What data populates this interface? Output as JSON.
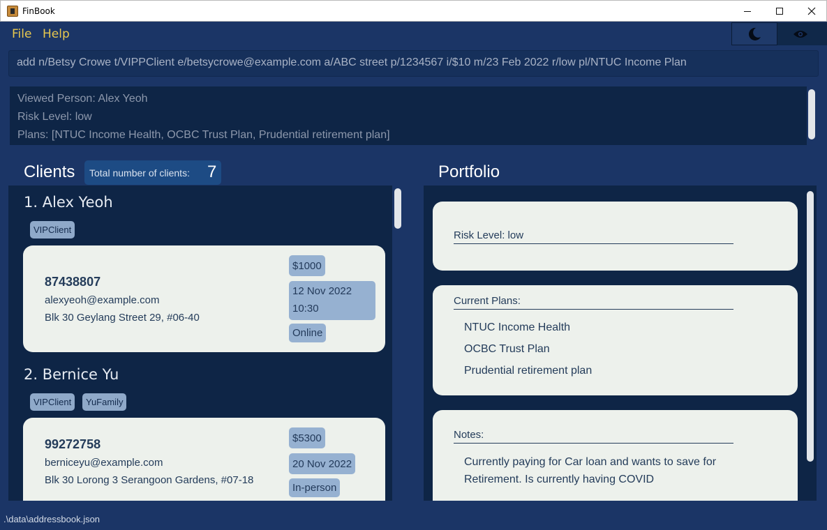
{
  "window": {
    "title": "FinBook"
  },
  "menu": {
    "file": "File",
    "help": "Help"
  },
  "toggles": {
    "dark_mode_icon": "moon-icon",
    "privacy_icon": "eye-icon"
  },
  "command": {
    "value": "add n/Betsy Crowe t/VIPPClient e/betsycrowe@example.com a/ABC street p/1234567 i/$10 m/23 Feb 2022 r/low pl/NTUC Income Plan"
  },
  "result": {
    "lines": [
      "Viewed Person: Alex Yeoh",
      "Risk Level: low",
      "Plans: [NTUC Income Health, OCBC Trust Plan, Prudential retirement plan]"
    ]
  },
  "clients": {
    "title": "Clients",
    "count_label": "Total number of clients:",
    "count": "7",
    "items": [
      {
        "name": "1.  Alex Yeoh",
        "tags": [
          "VIPClient"
        ],
        "phone": "87438807",
        "email": "alexyeoh@example.com",
        "address": "Blk 30 Geylang Street 29, #06-40",
        "income": "$1000",
        "meeting_date": "12 Nov 2022",
        "meeting_time": "10:30",
        "meeting_mode": "Online"
      },
      {
        "name": "2.  Bernice Yu",
        "tags": [
          "VIPClient",
          "YuFamily"
        ],
        "phone": "99272758",
        "email": "berniceyu@example.com",
        "address": "Blk 30 Lorong 3 Serangoon Gardens, #07-18",
        "income": "$5300",
        "meeting_date": "20 Nov 2022",
        "meeting_mode": "In-person"
      }
    ]
  },
  "portfolio": {
    "title": "Portfolio",
    "risk": "Risk Level: low",
    "plans_heading": "Current Plans:",
    "plans": [
      "NTUC Income Health",
      "OCBC Trust Plan",
      "Prudential retirement plan"
    ],
    "notes_heading": "Notes:",
    "notes": [
      "Currently paying for Car loan and wants to save for",
      "Retirement. Is currently having COVID"
    ]
  },
  "status": {
    "path": ".\\data\\addressbook.json"
  }
}
